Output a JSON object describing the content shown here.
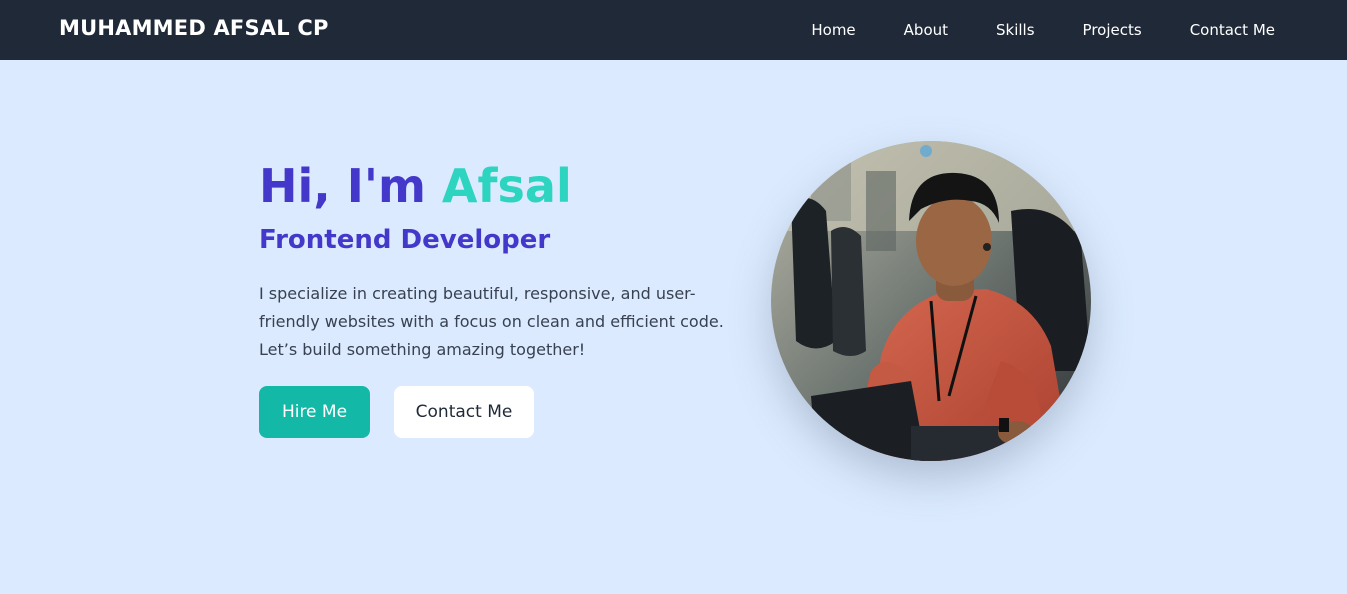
{
  "navbar": {
    "brand": "MUHAMMED AFSAL CP",
    "links": [
      "Home",
      "About",
      "Skills",
      "Projects",
      "Contact Me"
    ]
  },
  "hero": {
    "greeting": "Hi, I'm",
    "name": "Afsal",
    "role": "Frontend Developer",
    "description": "I specialize in creating beautiful, responsive, and user-friendly websites with a focus on clean and efficient code. Let’s build something amazing together!",
    "hire_button": "Hire Me",
    "contact_button": "Contact Me"
  },
  "colors": {
    "navbar_bg": "#1f2937",
    "page_bg": "#dbeafe",
    "accent_indigo": "#4338ca",
    "accent_teal": "#2dd4bf",
    "button_teal": "#14b8a6"
  }
}
